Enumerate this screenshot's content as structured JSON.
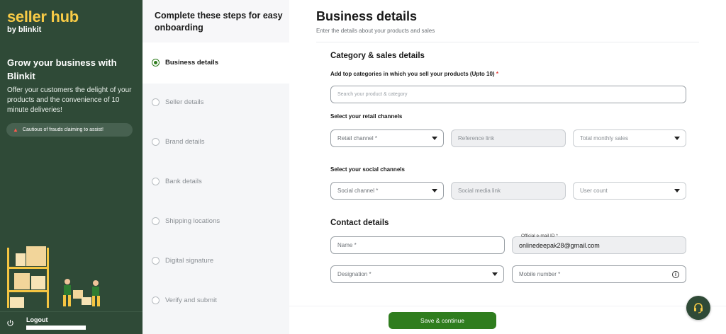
{
  "brand": {
    "main": "seller hub",
    "sub_prefix": "by ",
    "sub_name": "blinkit",
    "color": "#f8cb46"
  },
  "left_panel": {
    "heading": "Grow your business with Blinkit",
    "description": "Offer your customers the delight of your products and the convenience of 10 minute deliveries!",
    "fraud_warning": "Cautious of frauds claiming to assist!",
    "fraud_icon": "warning-triangle-icon",
    "logout_label": "Logout",
    "background_color": "#2f4a37"
  },
  "steps": {
    "heading": "Complete these steps for easy onboarding",
    "items": [
      {
        "label": "Business details",
        "active": true
      },
      {
        "label": "Seller details",
        "active": false
      },
      {
        "label": "Brand details",
        "active": false
      },
      {
        "label": "Bank details",
        "active": false
      },
      {
        "label": "Shipping locations",
        "active": false
      },
      {
        "label": "Digital signature",
        "active": false
      },
      {
        "label": "Verify and submit",
        "active": false
      }
    ]
  },
  "main": {
    "title": "Business details",
    "subtitle": "Enter the details about your products and sales",
    "category_section": {
      "title": "Category & sales details",
      "categories_label": "Add top categories in which you sell your products (Upto 10)",
      "categories_required": "*",
      "categories_placeholder": "Search your product & category",
      "retail_label": "Select your retail channels",
      "retail_channel_placeholder": "Retail channel *",
      "reference_link_placeholder": "Reference link",
      "monthly_sales_placeholder": "Total monthly sales",
      "social_label": "Select your social channels",
      "social_channel_placeholder": "Social channel *",
      "social_link_placeholder": "Social media link",
      "user_count_placeholder": "User count"
    },
    "contact_section": {
      "title": "Contact details",
      "name_placeholder": "Name *",
      "email_label": "Official e-mail ID *",
      "email_value": "onlinedeepak28@gmail.com",
      "designation_placeholder": "Designation *",
      "mobile_placeholder": "Mobile number *"
    },
    "save_button": "Save & continue",
    "accent_color": "#2f7d1e"
  }
}
